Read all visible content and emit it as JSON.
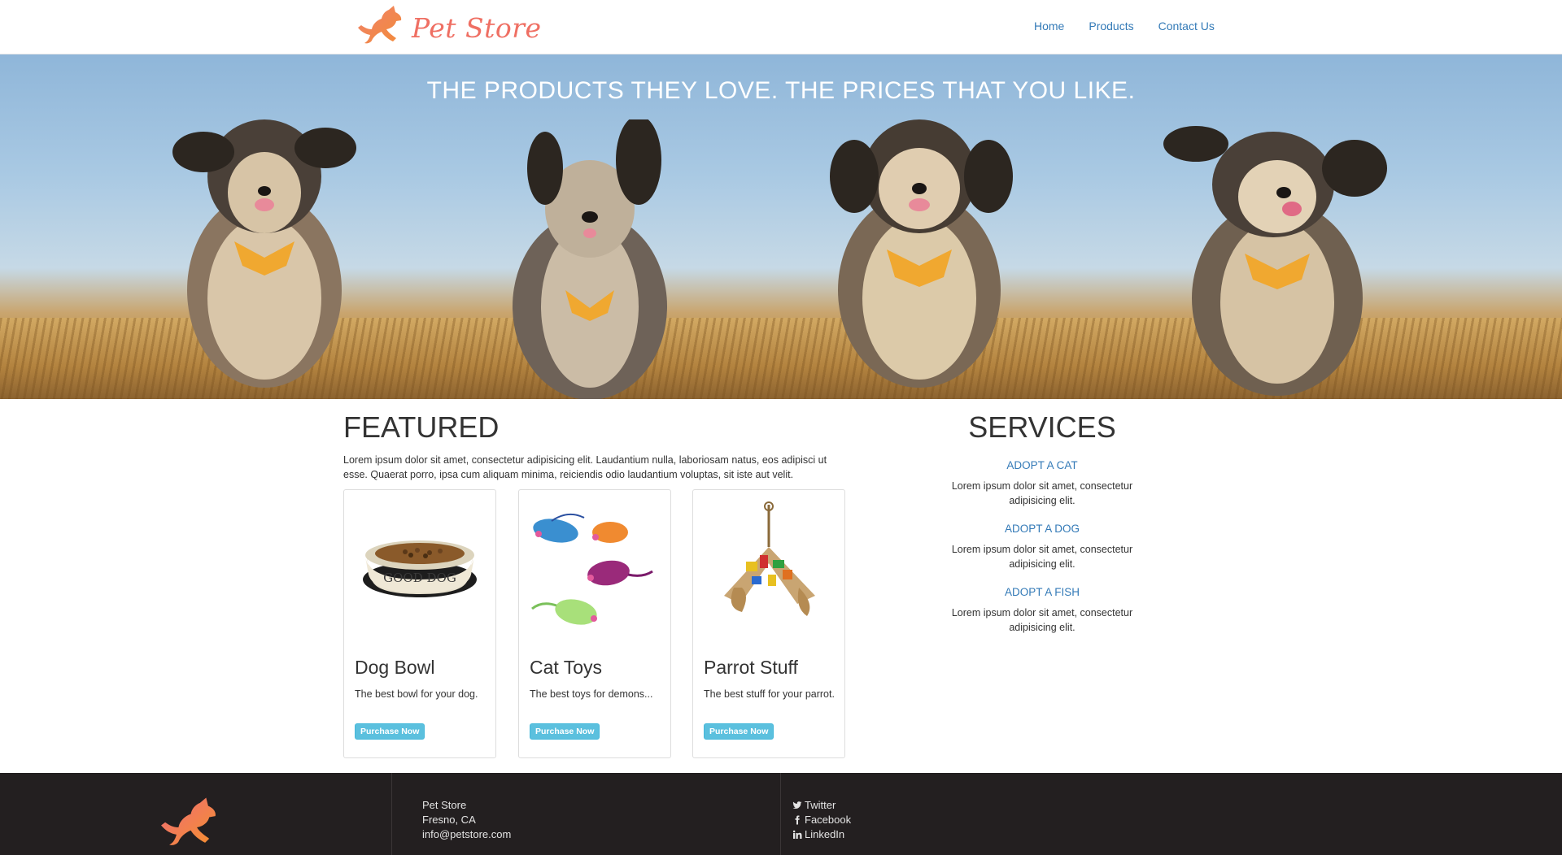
{
  "header": {
    "brand": "Pet Store",
    "nav": [
      "Home",
      "Products",
      "Contact Us"
    ]
  },
  "hero": {
    "title": "THE PRODUCTS THEY LOVE. THE PRICES THAT YOU LIKE."
  },
  "featured": {
    "title": "FEATURED",
    "description": "Lorem ipsum dolor sit amet, consectetur adipisicing elit. Laudantium nulla, laboriosam natus, eos adipisci ut esse. Quaerat porro, ipsa cum aliquam minima, reiciendis odio laudantium voluptas, sit iste aut velit.",
    "products": [
      {
        "title": "Dog Bowl",
        "description": "The best bowl for your dog.",
        "button": "Purchase Now",
        "image": "dog-bowl",
        "image_text": "GOOD DOG"
      },
      {
        "title": "Cat Toys",
        "description": "The best toys for demons...",
        "button": "Purchase Now",
        "image": "cat-toy-mice"
      },
      {
        "title": "Parrot Stuff",
        "description": "The best stuff for your parrot.",
        "button": "Purchase Now",
        "image": "parrot-toy"
      }
    ]
  },
  "services": {
    "title": "SERVICES",
    "items": [
      {
        "link": "ADOPT A CAT",
        "description": "Lorem ipsum dolor sit amet, consectetur adipisicing elit."
      },
      {
        "link": "ADOPT A DOG",
        "description": "Lorem ipsum dolor sit amet, consectetur adipisicing elit."
      },
      {
        "link": "ADOPT A FISH",
        "description": "Lorem ipsum dolor sit amet, consectetur adipisicing elit."
      }
    ]
  },
  "footer": {
    "address": [
      "Pet Store",
      "Fresno, CA",
      "info@petstore.com"
    ],
    "social": [
      {
        "label": "Twitter",
        "icon": "twitter-icon"
      },
      {
        "label": "Facebook",
        "icon": "facebook-icon"
      },
      {
        "label": "LinkedIn",
        "icon": "linkedin-icon"
      }
    ]
  },
  "colors": {
    "brand": "#ef6f63",
    "link": "#337ab7",
    "button": "#5bc0de",
    "footer_bg": "#231f20"
  }
}
